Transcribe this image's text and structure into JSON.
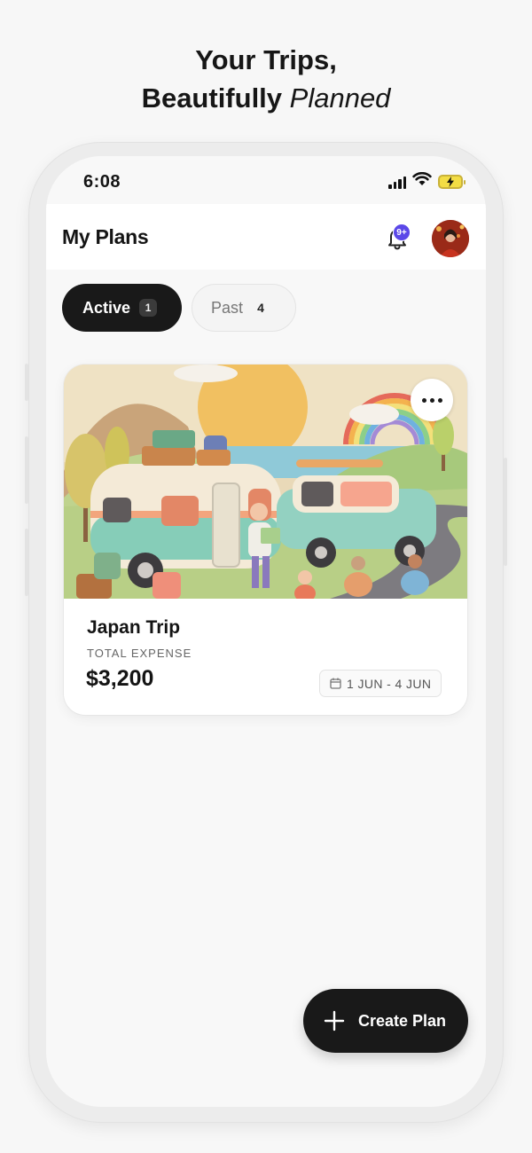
{
  "promo": {
    "line1": "Your Trips,",
    "line2_bold": "Beautifully",
    "line2_italic": "Planned"
  },
  "status_bar": {
    "time": "6:08",
    "icons": [
      "cellular-signal-icon",
      "wifi-icon",
      "battery-charging-icon"
    ]
  },
  "header": {
    "title": "My Plans",
    "notification_badge": "9+",
    "bell_icon": "bell-icon",
    "avatar_icon": "user-avatar"
  },
  "tabs": [
    {
      "label": "Active",
      "count": "1",
      "selected": true
    },
    {
      "label": "Past",
      "count": "4",
      "selected": false
    }
  ],
  "trip_card": {
    "name": "Japan Trip",
    "expense_label": "TOTAL EXPENSE",
    "expense_value": "$3,200",
    "date_range": "1 JUN - 4 JUN",
    "date_icon": "calendar-icon",
    "menu_icon": "more-horizontal-icon"
  },
  "fab": {
    "label": "Create Plan",
    "icon": "plus-icon"
  },
  "colors": {
    "primary_dark": "#191919",
    "badge": "#5b48e8",
    "background": "#f8f8f8",
    "card": "#ffffff"
  }
}
